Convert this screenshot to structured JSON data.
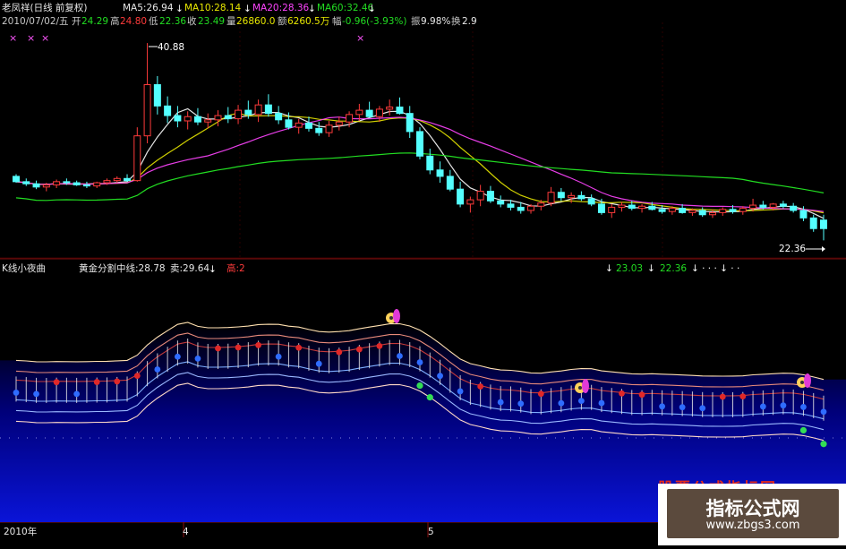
{
  "header": {
    "title": "老凤祥(日线 前复权)",
    "ma5": "MA5:26.94",
    "ma10": "MA10:28.14",
    "ma20": "MA20:28.36",
    "ma60": "MA60:32.46",
    "date": "2010/07/02/五",
    "open_label": "开",
    "open": "24.29",
    "high_label": "高",
    "high": "24.80",
    "low_label": "低",
    "low": "22.36",
    "close_label": "收",
    "close": "23.49",
    "vol_label": "量",
    "vol": "26860.0",
    "amt_label": "额",
    "amt": "6260.5万",
    "chg_label": "幅",
    "chg": "-0.96(-3.93%)",
    "amp_label": "振",
    "amp": "9.98%",
    "turn_label": "换",
    "turn": "2.9"
  },
  "lower_header": {
    "name": "K线小夜曲",
    "mid_line": "黄金分割中线:28.78",
    "sell": "卖:29.64",
    "high": "高:2",
    "v1": "23.03",
    "v2": "22.36"
  },
  "annotations": {
    "max_price": "40.88",
    "min_price": "22.36"
  },
  "xaxis": {
    "year": "2010年",
    "m4": "4",
    "m5": "5"
  },
  "watermark": {
    "main": "指标公式网",
    "url": "www.zbgs3.com",
    "red": "股票公式指标网"
  },
  "colors": {
    "up": "#ff3b3b",
    "down": "#54ffff",
    "ma5": "#ffffff",
    "ma10": "#e6e600",
    "ma20": "#ff44ff",
    "ma60": "#22dd22",
    "band": "#ffd9b0"
  },
  "chart_data": [
    {
      "type": "candlestick",
      "title": "老凤祥(日线 前复权)",
      "ylim": [
        21,
        42
      ],
      "ohlc": [
        [
          28.4,
          28.6,
          27.8,
          27.9
        ],
        [
          27.9,
          28.2,
          27.5,
          27.7
        ],
        [
          27.7,
          28.0,
          27.2,
          27.4
        ],
        [
          27.4,
          27.8,
          27.0,
          27.6
        ],
        [
          27.6,
          28.1,
          27.3,
          27.9
        ],
        [
          27.9,
          28.2,
          27.6,
          27.8
        ],
        [
          27.8,
          28.0,
          27.5,
          27.6
        ],
        [
          27.6,
          27.9,
          27.3,
          27.5
        ],
        [
          27.5,
          27.9,
          27.3,
          27.8
        ],
        [
          27.8,
          28.2,
          27.6,
          28.0
        ],
        [
          28.0,
          28.4,
          27.8,
          28.2
        ],
        [
          28.2,
          28.6,
          27.9,
          28.0
        ],
        [
          28.0,
          33.0,
          27.9,
          32.2
        ],
        [
          32.2,
          40.9,
          31.5,
          37.0
        ],
        [
          37.0,
          37.8,
          34.2,
          35.0
        ],
        [
          35.0,
          35.9,
          33.4,
          34.1
        ],
        [
          34.1,
          35.0,
          33.0,
          33.6
        ],
        [
          33.6,
          34.5,
          32.8,
          34.0
        ],
        [
          34.0,
          34.8,
          33.2,
          33.5
        ],
        [
          33.5,
          34.3,
          32.9,
          33.7
        ],
        [
          33.7,
          34.6,
          33.1,
          34.1
        ],
        [
          34.1,
          34.9,
          33.4,
          33.8
        ],
        [
          33.8,
          35.1,
          33.3,
          34.6
        ],
        [
          34.6,
          35.5,
          33.8,
          34.2
        ],
        [
          34.2,
          35.6,
          33.5,
          35.1
        ],
        [
          35.1,
          36.1,
          34.0,
          34.3
        ],
        [
          34.3,
          35.0,
          33.3,
          33.7
        ],
        [
          33.7,
          34.4,
          32.8,
          33.0
        ],
        [
          33.0,
          33.8,
          32.4,
          33.4
        ],
        [
          33.4,
          34.0,
          32.6,
          32.9
        ],
        [
          32.9,
          33.5,
          32.2,
          32.5
        ],
        [
          32.5,
          33.6,
          32.1,
          33.2
        ],
        [
          33.2,
          34.0,
          32.7,
          33.5
        ],
        [
          33.5,
          34.5,
          33.0,
          34.2
        ],
        [
          34.2,
          35.2,
          33.6,
          34.6
        ],
        [
          34.6,
          35.4,
          33.9,
          34.0
        ],
        [
          34.0,
          35.0,
          33.5,
          34.7
        ],
        [
          34.7,
          35.6,
          34.1,
          34.9
        ],
        [
          34.9,
          35.8,
          34.2,
          34.3
        ],
        [
          34.3,
          35.0,
          32.0,
          32.6
        ],
        [
          32.6,
          33.0,
          30.0,
          30.3
        ],
        [
          30.3,
          31.0,
          28.6,
          29.0
        ],
        [
          29.0,
          29.8,
          27.8,
          28.4
        ],
        [
          28.4,
          29.0,
          27.0,
          27.2
        ],
        [
          27.2,
          27.9,
          25.5,
          25.8
        ],
        [
          25.8,
          26.5,
          25.0,
          26.2
        ],
        [
          26.2,
          27.6,
          25.6,
          27.0
        ],
        [
          27.0,
          27.5,
          25.9,
          26.1
        ],
        [
          26.1,
          26.6,
          25.5,
          25.8
        ],
        [
          25.8,
          26.2,
          25.2,
          25.5
        ],
        [
          25.5,
          26.0,
          24.9,
          25.2
        ],
        [
          25.2,
          25.8,
          24.9,
          25.6
        ],
        [
          25.6,
          26.2,
          25.2,
          25.9
        ],
        [
          25.9,
          27.4,
          25.6,
          26.9
        ],
        [
          26.9,
          27.3,
          26.1,
          26.4
        ],
        [
          26.4,
          26.9,
          25.9,
          26.6
        ],
        [
          26.6,
          27.0,
          26.1,
          26.3
        ],
        [
          26.3,
          26.7,
          25.6,
          25.8
        ],
        [
          25.8,
          26.3,
          24.8,
          25.0
        ],
        [
          25.0,
          25.8,
          24.5,
          25.5
        ],
        [
          25.5,
          26.0,
          25.1,
          25.7
        ],
        [
          25.7,
          26.1,
          25.2,
          25.4
        ],
        [
          25.4,
          25.8,
          25.0,
          25.6
        ],
        [
          25.6,
          26.0,
          25.2,
          25.3
        ],
        [
          25.3,
          25.7,
          24.9,
          25.1
        ],
        [
          25.1,
          25.6,
          24.8,
          25.4
        ],
        [
          25.4,
          25.8,
          24.9,
          25.0
        ],
        [
          25.0,
          25.4,
          24.7,
          25.2
        ],
        [
          25.2,
          25.5,
          24.6,
          24.8
        ],
        [
          24.8,
          25.3,
          24.5,
          25.0
        ],
        [
          25.0,
          25.5,
          24.7,
          25.3
        ],
        [
          25.3,
          25.7,
          24.9,
          25.1
        ],
        [
          25.1,
          25.6,
          24.8,
          25.4
        ],
        [
          25.4,
          26.3,
          25.1,
          25.7
        ],
        [
          25.7,
          26.1,
          25.3,
          25.5
        ],
        [
          25.5,
          25.9,
          25.2,
          25.8
        ],
        [
          25.8,
          26.1,
          25.4,
          25.6
        ],
        [
          25.6,
          25.9,
          25.0,
          25.2
        ],
        [
          25.2,
          25.6,
          24.2,
          24.5
        ],
        [
          24.5,
          24.8,
          23.2,
          23.5
        ],
        [
          24.3,
          24.8,
          22.4,
          23.5
        ]
      ],
      "annotations": {
        "max": 40.88,
        "min": 22.36
      }
    },
    {
      "type": "line",
      "title": "K线小夜曲",
      "series": [
        {
          "name": "黄金分割中线",
          "last": 28.78
        },
        {
          "name": "卖",
          "last": 29.64
        }
      ]
    }
  ]
}
